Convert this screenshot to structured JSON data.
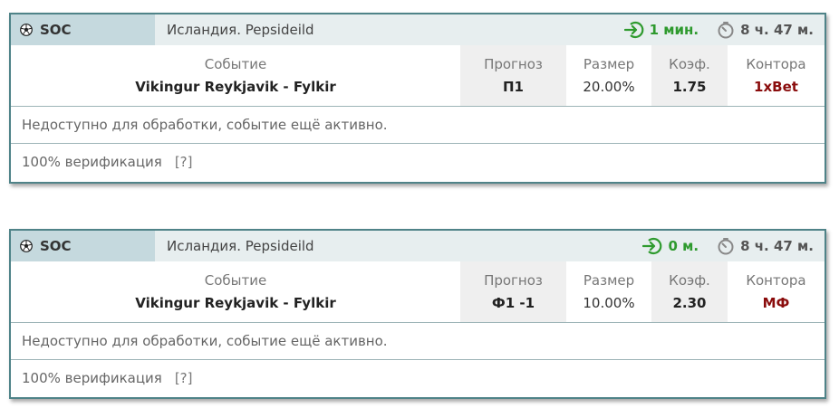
{
  "bets": [
    {
      "sport": "SOC",
      "league": "Исландия. Pepsideild",
      "time_remaining": "1 мин.",
      "time_total": "8 ч. 47 м.",
      "event_label": "Событие",
      "event": "Vikingur Reykjavik - Fylkir",
      "pick_label": "Прогноз",
      "pick": "П1",
      "stake_label": "Размер",
      "stake": "20.00%",
      "odds_label": "Коэф.",
      "odds": "1.75",
      "bookmaker_label": "Контора",
      "bookmaker": "1xBet",
      "note": "Недоступно для обработки, событие ещё активно.",
      "verification": "100% верификация",
      "help": "[?]"
    },
    {
      "sport": "SOC",
      "league": "Исландия. Pepsideild",
      "time_remaining": "0 м.",
      "time_total": "8 ч. 47 м.",
      "event_label": "Событие",
      "event": "Vikingur Reykjavik - Fylkir",
      "pick_label": "Прогноз",
      "pick": "Ф1 -1",
      "stake_label": "Размер",
      "stake": "10.00%",
      "odds_label": "Коэф.",
      "odds": "2.30",
      "bookmaker_label": "Контора",
      "bookmaker": "МФ",
      "note": "Недоступно для обработки, событие ещё активно.",
      "verification": "100% верификация",
      "help": "[?]"
    }
  ],
  "icons": {
    "sport": "soccer-ball-icon",
    "remaining": "enter-arrow-icon",
    "total": "stopwatch-icon"
  },
  "colors": {
    "remaining": "#2e9a2e",
    "bookmaker": "#8a0c0c",
    "border": "#4f8388",
    "sport_bg": "#c5d9de"
  }
}
